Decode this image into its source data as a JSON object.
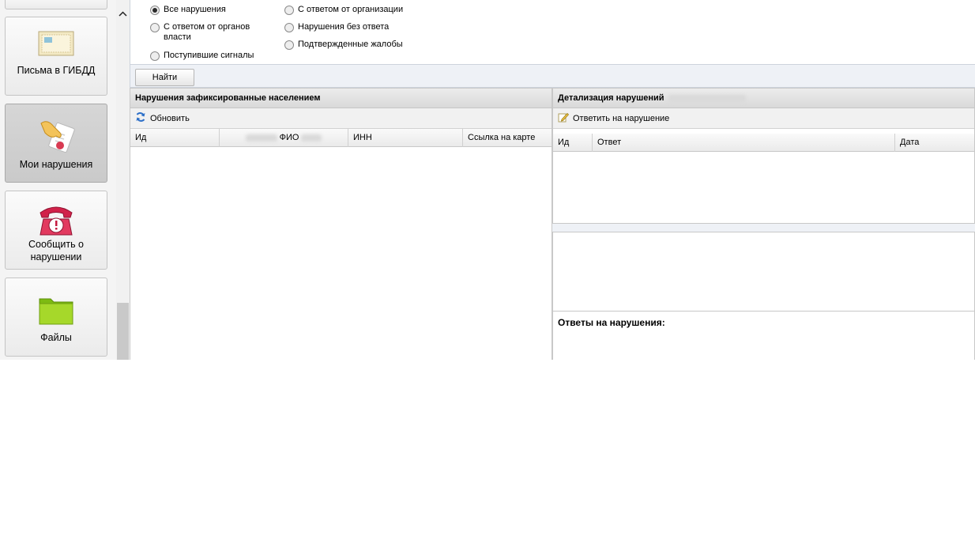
{
  "nav": {
    "tiles": [
      {
        "label": ""
      },
      {
        "label": "Письма в ГИБДД"
      },
      {
        "label": "Мои нарушения"
      },
      {
        "label": "Сообщить о нарушении"
      },
      {
        "label": "Файлы"
      }
    ]
  },
  "filter": {
    "options": [
      {
        "label": "Все нарушения",
        "checked": true
      },
      {
        "label": "С ответом от органов власти",
        "checked": false
      },
      {
        "label": "Поступившие сигналы",
        "checked": false
      },
      {
        "label": "С ответом от организации",
        "checked": false
      },
      {
        "label": "Нарушения без ответа",
        "checked": false
      },
      {
        "label": "Подтвержденные жалобы",
        "checked": false
      }
    ],
    "search_label": "Найти"
  },
  "left_panel": {
    "title": "Нарушения зафиксированные населением",
    "refresh_label": "Обновить",
    "columns": [
      "Ид",
      "ФИО",
      "ИНН",
      "Ссылка на карте"
    ]
  },
  "right_panel": {
    "title": "Детализация нарушений",
    "reply_label": "Ответить на нарушение",
    "columns": [
      "Ид",
      "Ответ",
      "Дата"
    ],
    "answers_label": "Ответы на нарушения:"
  }
}
